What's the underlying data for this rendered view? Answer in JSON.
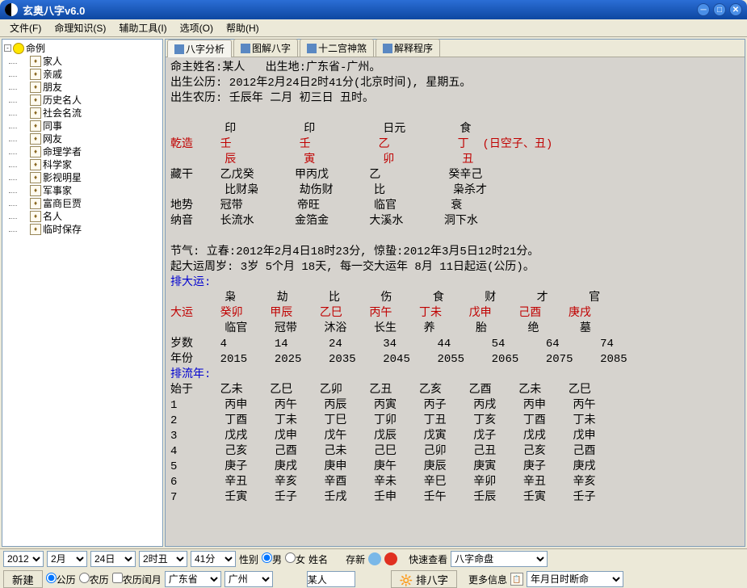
{
  "window": {
    "title": "玄奥八字v6.0"
  },
  "menu": [
    "文件(F)",
    "命理知识(S)",
    "辅助工具(I)",
    "选项(O)",
    "帮助(H)"
  ],
  "tree": {
    "root": "命例",
    "items": [
      "家人",
      "亲戚",
      "朋友",
      "历史名人",
      "社会名流",
      "同事",
      "网友",
      "命理学者",
      "科学家",
      "影视明星",
      "军事家",
      "富商巨贾",
      "名人",
      "临时保存"
    ]
  },
  "tabs": [
    "八字分析",
    "图解八字",
    "十二宫神煞",
    "解释程序"
  ],
  "content": {
    "l1": "命主姓名:某人   出生地:广东省-广州。",
    "l2": "出生公历: 2012年2月24日2时41分(北京时间), 星期五。",
    "l3": "出生农历: 壬辰年 二月 初三日 丑时。",
    "hdr": "        印          印          日元        食",
    "qz": "乾造    壬          壬          乙          丁  (日空子、丑)",
    "dz": "        辰          寅          卯          丑",
    "cang": "藏干    乙戊癸      甲丙戊      乙          癸辛己",
    "cangb": "        比财枭      劫伤财      比          枭杀才",
    "dishi": "地势    冠带        帝旺        临官        衰",
    "nayin": "纳音    长流水      金箔金      大溪水      洞下水",
    "jq1": "节气: 立春:2012年2月4日18时23分, 惊蛰:2012年3月5日12时21分。",
    "jq2": "起大运周岁: 3岁 5个月 18天, 每一交大运年 8月 11日起运(公历)。",
    "pdy": "排大运:",
    "dy1": "        枭      劫      比      伤      食      财      才      官",
    "dy2": "大运    癸卯    甲辰    乙巳    丙午    丁未    戊申    己酉    庚戌",
    "dy3": "        临官    冠带    沐浴    长生    养      胎      绝      墓",
    "dy4": "岁数    4       14      24      34      44      54      64      74",
    "dy5": "年份    2015    2025    2035    2045    2055    2065    2075    2085",
    "pln": "排流年:",
    "ln0": "始于    乙未    乙巳    乙卯    乙丑    乙亥    乙酉    乙未    乙巳",
    "ln1": "1       丙申    丙午    丙辰    丙寅    丙子    丙戌    丙申    丙午",
    "ln2": "2       丁酉    丁未    丁巳    丁卯    丁丑    丁亥    丁酉    丁未",
    "ln3": "3       戊戌    戊申    戊午    戊辰    戊寅    戊子    戊戌    戊申",
    "ln4": "4       己亥    己酉    己未    己巳    己卯    己丑    己亥    己酉",
    "ln5": "5       庚子    庚戌    庚申    庚午    庚辰    庚寅    庚子    庚戌",
    "ln6": "6       辛丑    辛亥    辛酉    辛未    辛巳    辛卯    辛丑    辛亥",
    "ln7": "7       壬寅    壬子    壬戌    壬申    壬午    壬辰    壬寅    壬子"
  },
  "bottom": {
    "year": "2012",
    "month": "2月",
    "day": "24日",
    "hour": "2时丑",
    "min": "41分",
    "new_btn": "新建",
    "gl": "公历",
    "nl": "农历",
    "nlry": "农历闰月",
    "prov": "广东省",
    "city": "广州",
    "sex_label": "性别",
    "male": "男",
    "female": "女",
    "name_label": "姓名",
    "name_val": "某人",
    "cunxin": "存新",
    "paibazi": "排八字",
    "kscz": "快速查看",
    "kscz_val": "八字命盘",
    "gdxx": "更多信息",
    "gdxx_val": "年月日时断命"
  }
}
